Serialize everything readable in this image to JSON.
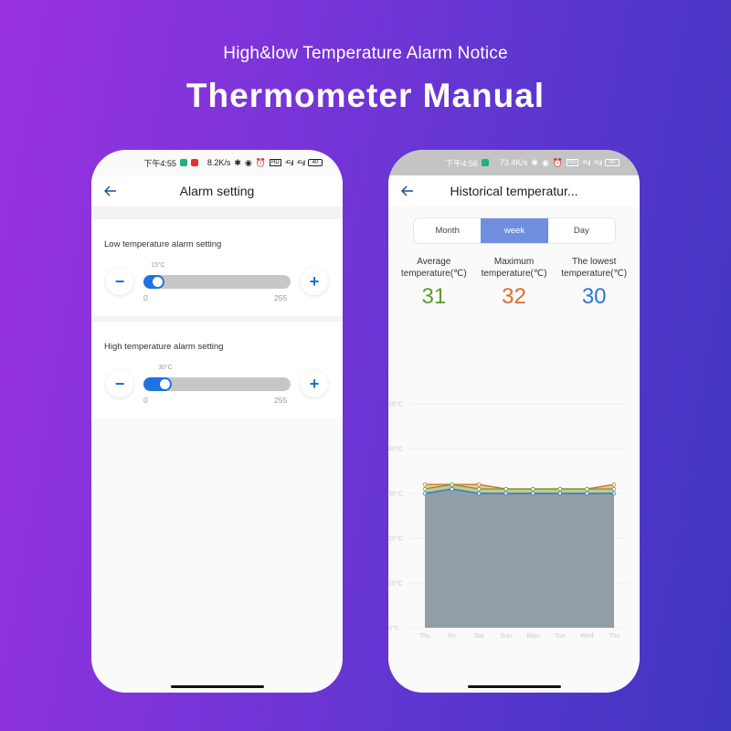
{
  "header": {
    "subtitle": "High&low Temperature Alarm Notice",
    "title": "Thermometer Manual"
  },
  "left_phone": {
    "status_bar": {
      "time": "下午4:55",
      "speed": "8.2K/s",
      "signal1": "⁴ᴳ.ıl",
      "signal2": "⁴ᴳ.ıl",
      "battery": "40"
    },
    "nav": {
      "back_icon": "arrow-left-icon",
      "title": "Alarm setting"
    },
    "low_alarm": {
      "label": "Low temperature alarm setting",
      "value_label": "15°C",
      "value": 15,
      "min": "0",
      "max": "255",
      "minus": "−",
      "plus": "+"
    },
    "high_alarm": {
      "label": "High temperature alarm setting",
      "value_label": "30°C",
      "value": 30,
      "min": "0",
      "max": "255",
      "minus": "−",
      "plus": "+"
    }
  },
  "right_phone": {
    "status_bar": {
      "time": "下午4:56",
      "speed": "73.4K/s",
      "signal1": "⁴ᴳ.ıl",
      "signal2": "⁴ᴳ.ıl",
      "battery": "40"
    },
    "nav": {
      "back_icon": "arrow-left-icon",
      "title": "Historical temperatur..."
    },
    "tabs": [
      {
        "label": "Month",
        "active": false
      },
      {
        "label": "week",
        "active": true
      },
      {
        "label": "Day",
        "active": false
      }
    ],
    "stats": [
      {
        "label_line1": "Average",
        "label_line2": "temperature(℃)",
        "value": "31",
        "color": "#5a9e2f"
      },
      {
        "label_line1": "Maximum",
        "label_line2": "temperature(℃)",
        "value": "32",
        "color": "#e06a2a"
      },
      {
        "label_line1": "The lowest",
        "label_line2": "temperature(℃)",
        "value": "30",
        "color": "#2b7ac9"
      }
    ]
  },
  "colors": {
    "accent_blue": "#1f72e0",
    "tab_active": "#6f8fde",
    "area_fill": "#919ea6"
  },
  "chart_data": {
    "type": "line",
    "title": "",
    "xlabel": "",
    "ylabel": "",
    "categories": [
      "Thu",
      "Fri",
      "Sat",
      "Sun",
      "Mon",
      "Tue",
      "Wed",
      "Thu"
    ],
    "yticks": [
      "0°C",
      "10°C",
      "20°C",
      "30°C",
      "40°C",
      "50°C"
    ],
    "ylim": [
      0,
      50
    ],
    "grid": true,
    "area_series": "Lowest",
    "series": [
      {
        "name": "Maximum",
        "color": "#e06a2a",
        "values": [
          32,
          32,
          32,
          31,
          31,
          31,
          31,
          32
        ]
      },
      {
        "name": "Average",
        "color": "#6aa33a",
        "values": [
          31,
          32,
          31,
          31,
          31,
          31,
          31,
          31
        ]
      },
      {
        "name": "Lowest",
        "color": "#2b7ac9",
        "values": [
          30,
          31,
          30,
          30,
          30,
          30,
          30,
          30
        ]
      }
    ]
  }
}
